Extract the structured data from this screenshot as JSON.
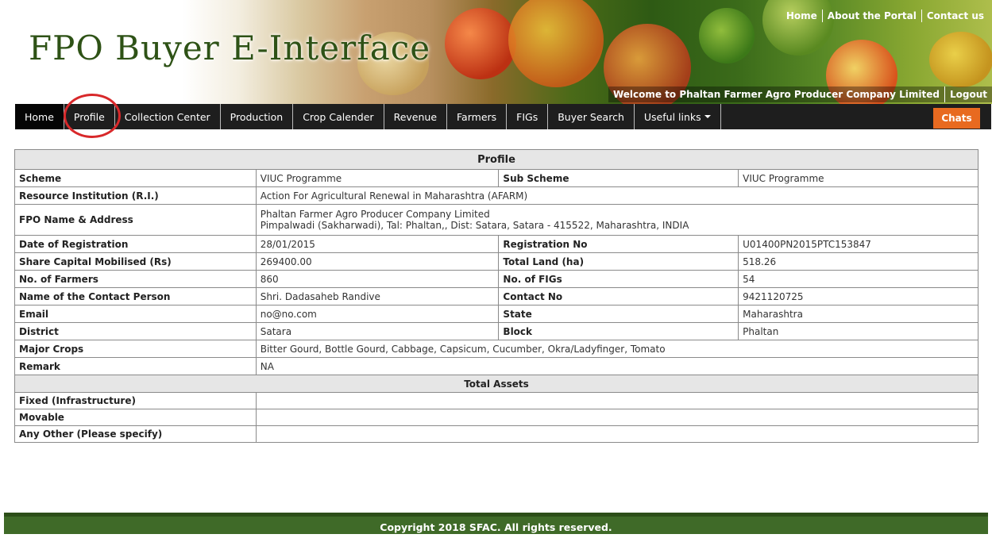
{
  "header": {
    "title": "FPO Buyer E-Interface",
    "top_links": [
      "Home",
      "About the Portal",
      "Contact us"
    ],
    "welcome": "Welcome to Phaltan Farmer Agro Producer Company Limited",
    "logout": "Logout"
  },
  "nav": {
    "items": [
      "Home",
      "Profile",
      "Collection Center",
      "Production",
      "Crop Calender",
      "Revenue",
      "Farmers",
      "FIGs",
      "Buyer Search",
      "Useful links"
    ],
    "chats": "Chats"
  },
  "profile": {
    "heading": "Profile",
    "scheme_label": "Scheme",
    "scheme": "VIUC Programme",
    "sub_scheme_label": "Sub Scheme",
    "sub_scheme": "VIUC Programme",
    "ri_label": "Resource Institution (R.I.)",
    "ri": "Action For Agricultural Renewal in Maharashtra (AFARM)",
    "fpo_label": "FPO Name & Address",
    "fpo_name": "Phaltan Farmer Agro Producer Company Limited",
    "fpo_address": "Pimpalwadi (Sakharwadi), Tal: Phaltan,, Dist: Satara, Satara - 415522, Maharashtra, INDIA",
    "reg_date_label": "Date of Registration",
    "reg_date": "28/01/2015",
    "reg_no_label": "Registration No",
    "reg_no": "U01400PN2015PTC153847",
    "share_label": "Share Capital Mobilised (Rs)",
    "share": "269400.00",
    "land_label": "Total Land (ha)",
    "land": "518.26",
    "farmers_label": "No. of Farmers",
    "farmers": "860",
    "figs_label": "No. of FIGs",
    "figs": "54",
    "contact_person_label": "Name of the Contact Person",
    "contact_person": "Shri. Dadasaheb Randive",
    "contact_no_label": "Contact No",
    "contact_no": "9421120725",
    "email_label": "Email",
    "email": "no@no.com",
    "state_label": "State",
    "state": "Maharashtra",
    "district_label": "District",
    "district": "Satara",
    "block_label": "Block",
    "block": "Phaltan",
    "crops_label": "Major Crops",
    "crops": "Bitter Gourd, Bottle Gourd, Cabbage, Capsicum, Cucumber, Okra/Ladyfinger, Tomato",
    "remark_label": "Remark",
    "remark": "NA"
  },
  "assets": {
    "heading": "Total Assets",
    "fixed_label": "Fixed (Infrastructure)",
    "fixed": "",
    "movable_label": "Movable",
    "movable": "",
    "other_label": "Any Other (Please specify)",
    "other": ""
  },
  "footer": {
    "copyright": "Copyright 2018 SFAC. All rights reserved."
  }
}
